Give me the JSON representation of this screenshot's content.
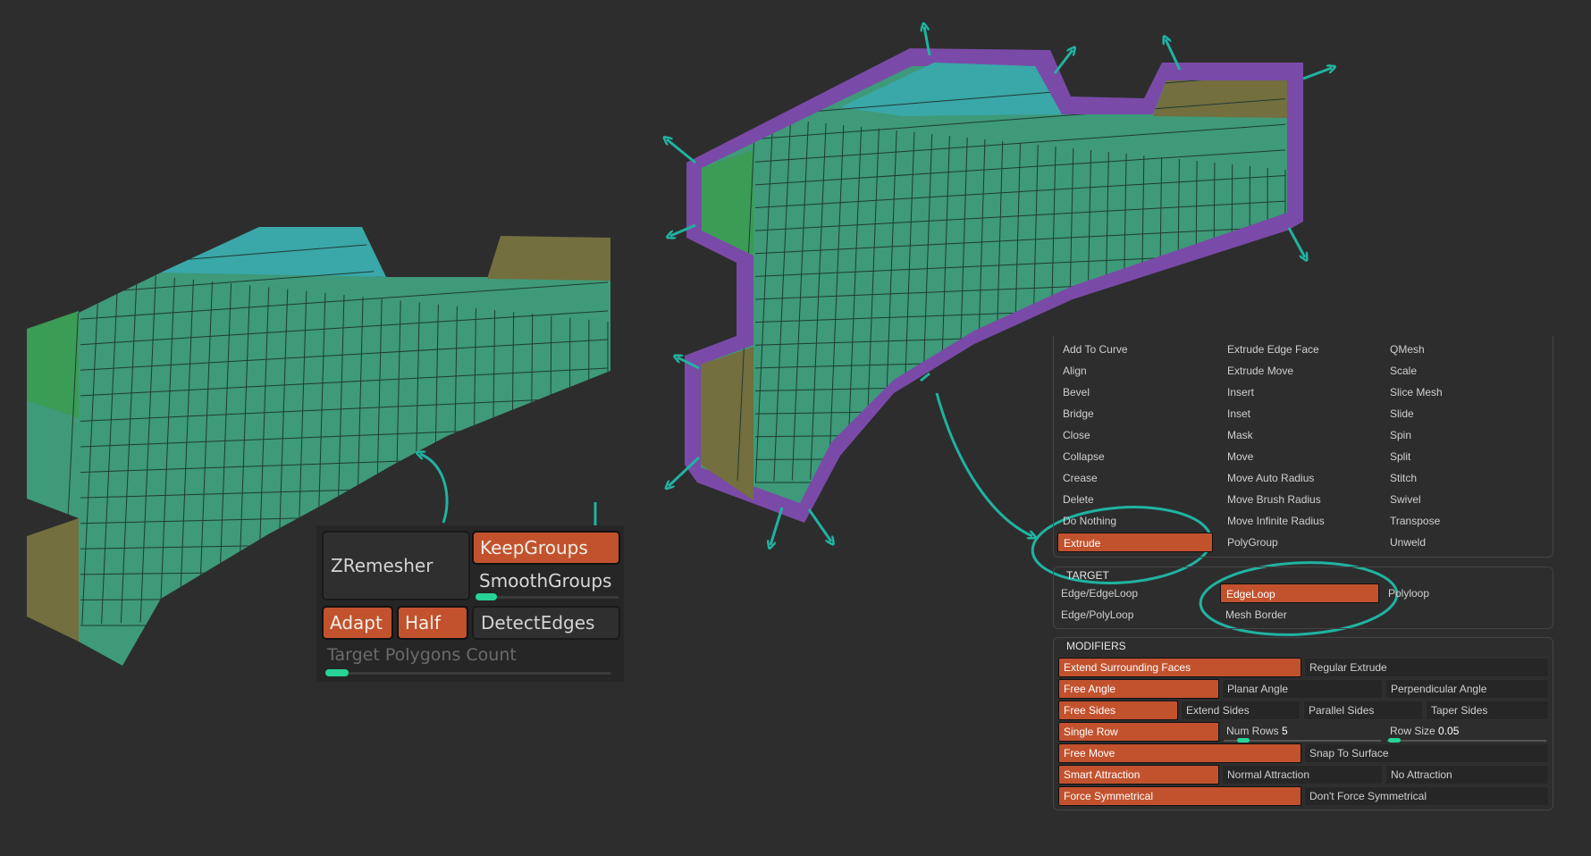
{
  "colors": {
    "background": "#2d2d2d",
    "mesh_green": "#3e9a78",
    "mesh_cyan": "#3aa7a9",
    "mesh_bright_green": "#3a9c55",
    "mesh_olive": "#736f3f",
    "mesh_purple": "#7a4aa8",
    "annotation_teal": "#20b3a0",
    "button_active": "#c2522e",
    "slider_accent": "#27d496"
  },
  "zremesher": {
    "title": "ZRemesher",
    "keep_groups": "KeepGroups",
    "smooth_groups": "SmoothGroups",
    "adapt": "Adapt",
    "half": "Half",
    "detect_edges": "DetectEdges",
    "target_polygons": "Target Polygons Count",
    "smooth_groups_level": 0.15,
    "target_polygons_level": 0.08
  },
  "actions": {
    "col1": [
      "Add To Curve",
      "Align",
      "Bevel",
      "Bridge",
      "Close",
      "Collapse",
      "Crease",
      "Delete",
      "Do Nothing",
      "Extrude"
    ],
    "col2": [
      "Extrude Edge Face",
      "Extrude Move",
      "Insert",
      "Inset",
      "Mask",
      "Move",
      "Move Auto Radius",
      "Move Brush Radius",
      "Move Infinite Radius",
      "PolyGroup"
    ],
    "col3": [
      "QMesh",
      "Scale",
      "Slice Mesh",
      "Slide",
      "Spin",
      "Split",
      "Stitch",
      "Swivel",
      "Transpose",
      "Unweld"
    ],
    "selected": "Extrude"
  },
  "target": {
    "title": "TARGET",
    "items": [
      "Edge/EdgeLoop",
      "EdgeLoop",
      "Polyloop",
      "Edge/PolyLoop",
      "Mesh Border"
    ],
    "selected": "EdgeLoop"
  },
  "modifiers": {
    "title": "MODIFIERS",
    "extend_surrounding": "Extend Surrounding Faces",
    "regular_extrude": "Regular Extrude",
    "free_angle": "Free Angle",
    "planar_angle": "Planar Angle",
    "perpendicular_angle": "Perpendicular Angle",
    "free_sides": "Free Sides",
    "extend_sides": "Extend Sides",
    "parallel_sides": "Parallel Sides",
    "taper_sides": "Taper Sides",
    "single_row": "Single Row",
    "num_rows_label": "Num Rows",
    "num_rows_value": "5",
    "row_size_label": "Row Size",
    "row_size_value": "0.05",
    "free_move": "Free Move",
    "snap_to_surface": "Snap To Surface",
    "smart_attraction": "Smart Attraction",
    "normal_attraction": "Normal Attraction",
    "no_attraction": "No Attraction",
    "force_symmetrical": "Force Symmetrical",
    "dont_force_symmetrical": "Don't Force Symmetrical"
  }
}
